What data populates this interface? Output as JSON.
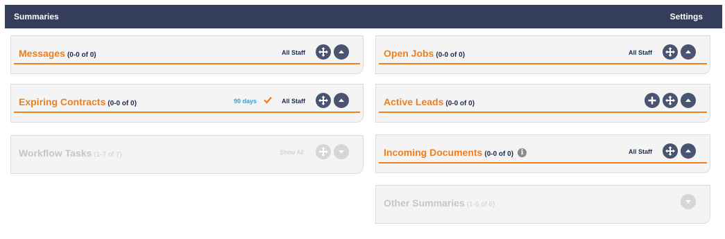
{
  "topbar": {
    "title": "Summaries",
    "settings": "Settings"
  },
  "panels": {
    "messages": {
      "title": "Messages",
      "count": "(0-0 of 0)",
      "staff": "All Staff"
    },
    "expiring": {
      "title": "Expiring Contracts",
      "count": "(0-0 of 0)",
      "days": "90 days",
      "staff": "All Staff"
    },
    "workflow": {
      "title": "Workflow Tasks",
      "count": "(1-7 of 7)",
      "staff": "Show All"
    },
    "openjobs": {
      "title": "Open Jobs",
      "count": "(0-0 of 0)",
      "staff": "All Staff"
    },
    "leads": {
      "title": "Active Leads",
      "count": "(0-0 of 0)"
    },
    "incoming": {
      "title": "Incoming Documents",
      "count": "(0-0 of 0)",
      "staff": "All Staff"
    },
    "other": {
      "title": "Other Summaries",
      "count": "(1-6 of 6)"
    }
  },
  "icons": {
    "move": "move-arrows-icon",
    "collapse": "chevron-up-icon",
    "expand": "chevron-down-icon",
    "add": "plus-icon",
    "info": "info-icon",
    "check": "checkmark-icon"
  },
  "colors": {
    "header_bg": "#343d5a",
    "accent_orange": "#ef7e1b",
    "link_blue": "#3b9fce",
    "button_dark": "#4a5470",
    "disabled": "#d6d6d6"
  }
}
